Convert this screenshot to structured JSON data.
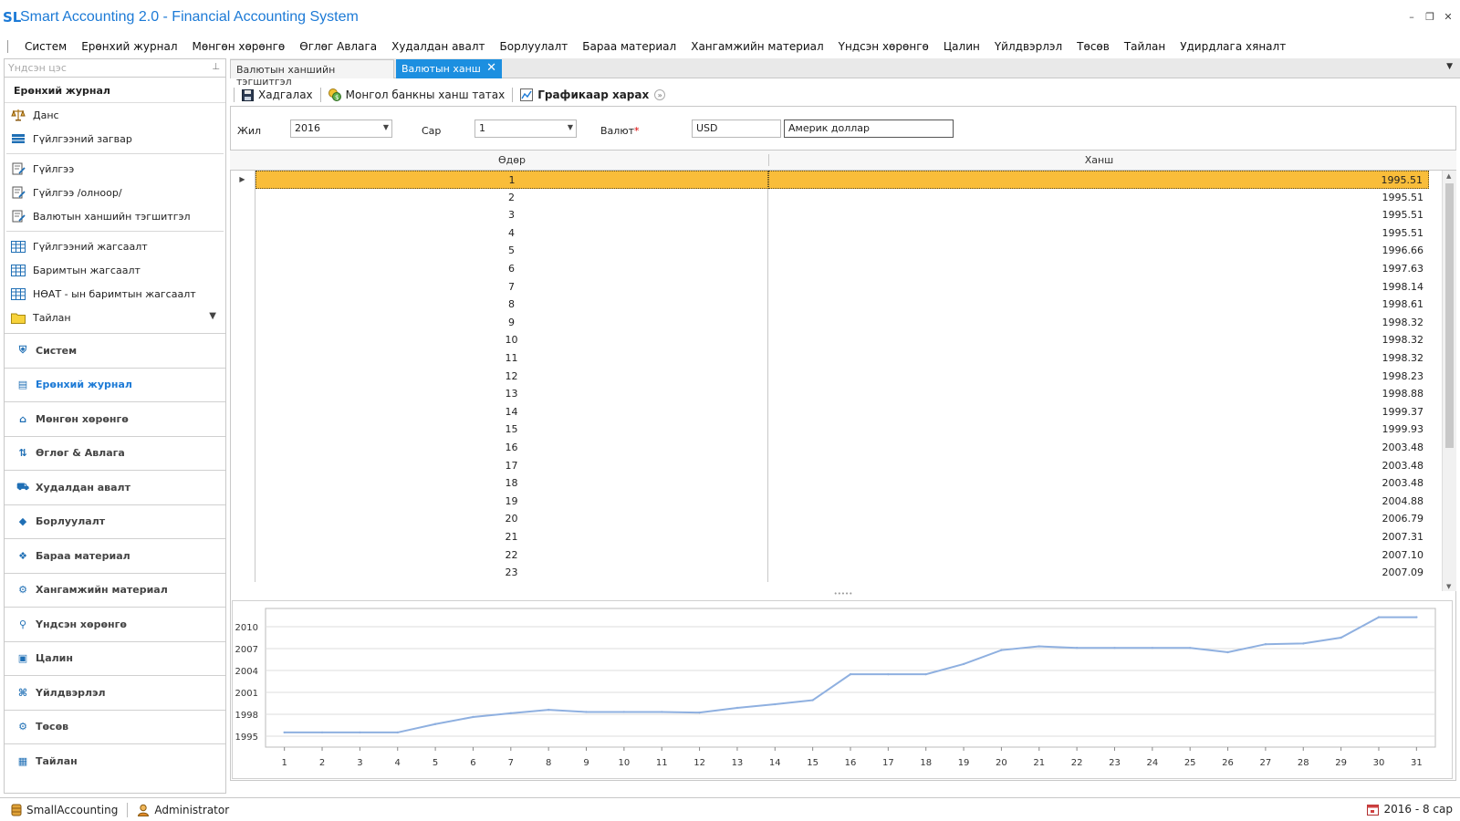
{
  "app": {
    "logo": "SL",
    "title": "Smart Accounting 2.0 - Financial Accounting System"
  },
  "menu": [
    "Систем",
    "Ерөнхий журнал",
    "Мөнгөн хөрөнгө",
    "Өглөг Авлага",
    "Худалдан авалт",
    "Борлуулалт",
    "Бараа материал",
    "Хангамжийн материал",
    "Үндсэн хөрөнгө",
    "Цалин",
    "Үйлдвэрлэл",
    "Төсөв",
    "Тайлан",
    "Удирдлага хяналт"
  ],
  "left_panel": {
    "header": "Үндсэн цэс",
    "group_title": "Ерөнхий журнал",
    "items": [
      {
        "label": "Данс",
        "icon": "scales-icon"
      },
      {
        "label": "Гүйлгээний загвар",
        "icon": "template-icon"
      },
      {
        "label": "Гүйлгээ",
        "icon": "edit-doc-icon"
      },
      {
        "label": "Гүйлгээ /олноор/",
        "icon": "edit-doc-icon"
      },
      {
        "label": "Валютын ханшийн тэгшитгэл",
        "icon": "edit-doc-icon"
      },
      {
        "label": "Гүйлгээний жагсаалт",
        "icon": "grid-icon"
      },
      {
        "label": "Баримтын жагсаалт",
        "icon": "grid-icon"
      },
      {
        "label": "НӨАТ - ын баримтын жагсаалт",
        "icon": "grid-icon"
      },
      {
        "label": "Тайлан",
        "icon": "folder-icon"
      }
    ],
    "nav": [
      {
        "label": "Систем",
        "icon": "shield-icon",
        "active": false
      },
      {
        "label": "Ерөнхий журнал",
        "icon": "clipboard-icon",
        "active": true
      },
      {
        "label": "Мөнгөн хөрөнгө",
        "icon": "bank-icon",
        "active": false
      },
      {
        "label": "Өглөг & Авлага",
        "icon": "arrows-icon",
        "active": false
      },
      {
        "label": "Худалдан авалт",
        "icon": "cart-icon",
        "active": false
      },
      {
        "label": "Борлуулалт",
        "icon": "tag-icon",
        "active": false
      },
      {
        "label": "Бараа материал",
        "icon": "boxes-icon",
        "active": false
      },
      {
        "label": "Хангамжийн материал",
        "icon": "gear-icon",
        "active": false
      },
      {
        "label": "Үндсэн хөрөнгө",
        "icon": "person-icon",
        "active": false
      },
      {
        "label": "Цалин",
        "icon": "money-icon",
        "active": false
      },
      {
        "label": "Үйлдвэрлэл",
        "icon": "factory-icon",
        "active": false
      },
      {
        "label": "Төсөв",
        "icon": "gear-icon",
        "active": false
      },
      {
        "label": "Тайлан",
        "icon": "report-icon",
        "active": false
      }
    ]
  },
  "tabs": [
    {
      "label": "Валютын ханшийн тэгшитгэл",
      "active": false
    },
    {
      "label": "Валютын ханш",
      "active": true
    }
  ],
  "toolbar": {
    "save": "Хадгалах",
    "fetch": "Монгол банкны ханш татах",
    "chart": "Графикаар харах"
  },
  "filters": {
    "year_label": "Жил",
    "year_value": "2016",
    "month_label": "Сар",
    "month_value": "1",
    "currency_label": "Валют",
    "currency_code": "USD",
    "currency_name": "Америк доллар"
  },
  "grid": {
    "col_day": "Өдөр",
    "col_rate": "Ханш",
    "selected_row": 0,
    "rows": [
      {
        "day": "1",
        "rate": "1995.51"
      },
      {
        "day": "2",
        "rate": "1995.51"
      },
      {
        "day": "3",
        "rate": "1995.51"
      },
      {
        "day": "4",
        "rate": "1995.51"
      },
      {
        "day": "5",
        "rate": "1996.66"
      },
      {
        "day": "6",
        "rate": "1997.63"
      },
      {
        "day": "7",
        "rate": "1998.14"
      },
      {
        "day": "8",
        "rate": "1998.61"
      },
      {
        "day": "9",
        "rate": "1998.32"
      },
      {
        "day": "10",
        "rate": "1998.32"
      },
      {
        "day": "11",
        "rate": "1998.32"
      },
      {
        "day": "12",
        "rate": "1998.23"
      },
      {
        "day": "13",
        "rate": "1998.88"
      },
      {
        "day": "14",
        "rate": "1999.37"
      },
      {
        "day": "15",
        "rate": "1999.93"
      },
      {
        "day": "16",
        "rate": "2003.48"
      },
      {
        "day": "17",
        "rate": "2003.48"
      },
      {
        "day": "18",
        "rate": "2003.48"
      },
      {
        "day": "19",
        "rate": "2004.88"
      },
      {
        "day": "20",
        "rate": "2006.79"
      },
      {
        "day": "21",
        "rate": "2007.31"
      },
      {
        "day": "22",
        "rate": "2007.10"
      },
      {
        "day": "23",
        "rate": "2007.09"
      }
    ]
  },
  "chart_data": {
    "type": "line",
    "x": [
      1,
      2,
      3,
      4,
      5,
      6,
      7,
      8,
      9,
      10,
      11,
      12,
      13,
      14,
      15,
      16,
      17,
      18,
      19,
      20,
      21,
      22,
      23,
      24,
      25,
      26,
      27,
      28,
      29,
      30,
      31
    ],
    "series": [
      {
        "values": [
          1995.51,
          1995.51,
          1995.51,
          1995.51,
          1996.66,
          1997.63,
          1998.14,
          1998.61,
          1998.32,
          1998.32,
          1998.32,
          1998.23,
          1998.88,
          1999.37,
          1999.93,
          2003.48,
          2003.48,
          2003.48,
          2004.88,
          2006.79,
          2007.31,
          2007.1,
          2007.09,
          2007.09,
          2007.09,
          2006.5,
          2007.6,
          2007.7,
          2008.5,
          2011.3,
          2011.3
        ]
      }
    ],
    "y_ticks": [
      1995,
      1998,
      2001,
      2004,
      2007,
      2010
    ],
    "ylim": [
      1993.5,
      2012.5
    ],
    "xlim": [
      0.5,
      31.5
    ],
    "grid": true,
    "line_color": "#8fb0e0"
  },
  "status": {
    "db": "SmallAccounting",
    "user": "Administrator",
    "period": "2016 - 8 сар"
  }
}
